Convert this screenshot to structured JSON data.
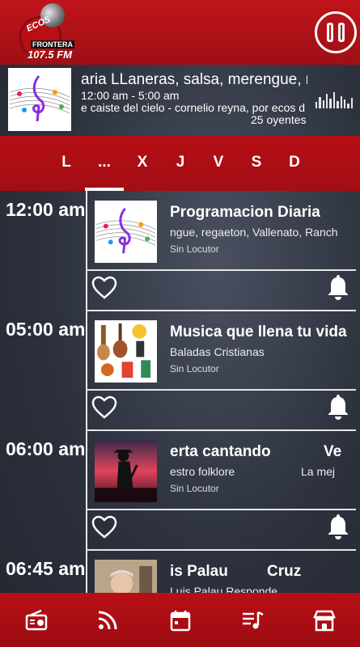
{
  "app": {
    "logo_texts": [
      "ECOS",
      "FRONTERA",
      "107.5 FM"
    ]
  },
  "header": {
    "pause_icon": "pause-icon"
  },
  "now_playing": {
    "title": "aria  LLaneras, salsa, merengue, re",
    "time": "12:00 am - 5:00 am",
    "song": "e caiste del cielo - cornelio reyna, por ecos d",
    "listeners": "25 oyentes"
  },
  "day_tabs": [
    {
      "label": "L"
    },
    {
      "label": "..."
    },
    {
      "label": "X"
    },
    {
      "label": "J"
    },
    {
      "label": "V"
    },
    {
      "label": "S"
    },
    {
      "label": "D"
    }
  ],
  "programs": [
    {
      "time": "12:00 am",
      "title": "Programacion Diaria",
      "subtitle": "ngue, regaeton, Vallenato, Ranch",
      "locutor": "Sin Locutor"
    },
    {
      "time": "05:00 am",
      "title": "Musica que llena tu vida",
      "subtitle": "Baladas Cristianas",
      "locutor": "Sin Locutor"
    },
    {
      "time": "06:00 am",
      "title": "erta cantando",
      "title_right": "Ve",
      "subtitle": "estro folklore",
      "subtitle_right": "La mej",
      "locutor": "Sin Locutor"
    },
    {
      "time": "06:45 am",
      "title": "is Palau",
      "title_right": "Cruz",
      "subtitle": "Luis Palau Responde",
      "locutor": ""
    }
  ],
  "bottom_nav": [
    {
      "icon": "radio-icon"
    },
    {
      "icon": "rss-icon"
    },
    {
      "icon": "calendar-icon"
    },
    {
      "icon": "playlist-icon"
    },
    {
      "icon": "store-icon"
    }
  ],
  "colors": {
    "brand_red": "#b50f16",
    "background": "#2c313d"
  }
}
